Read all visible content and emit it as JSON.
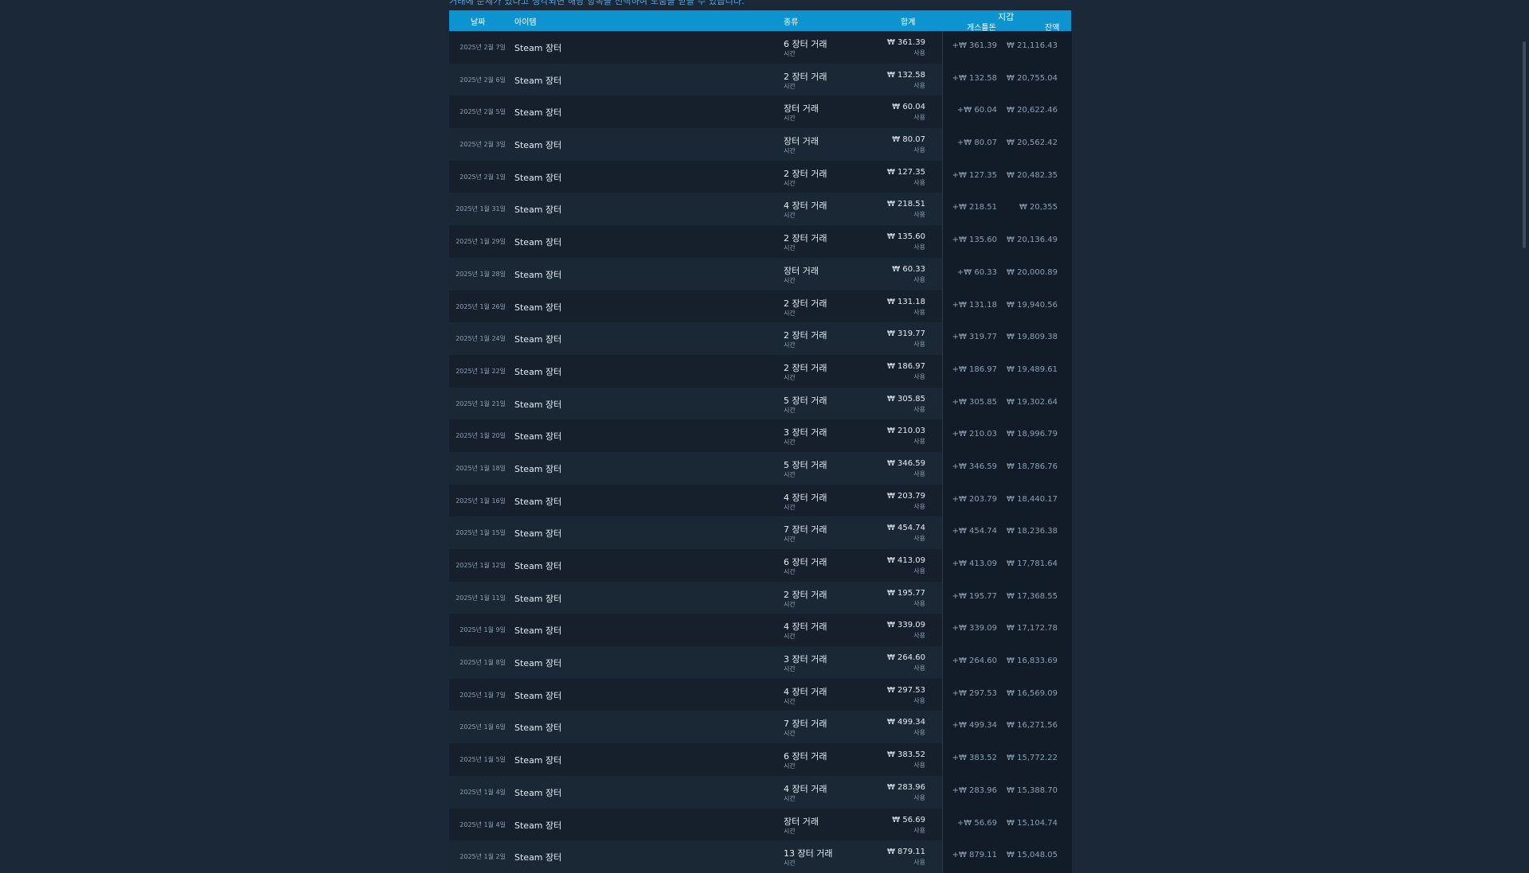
{
  "intro_text": "거래에 문제가 있다고 생각되면 해당 항목을 선택하여 도움을 받을 수 있습니다.",
  "headers": {
    "date": "날짜",
    "item": "아이템",
    "type": "종류",
    "total": "합계",
    "wallet": "지갑",
    "change": "게스틀돈",
    "balance": "잔액"
  },
  "rows": [
    {
      "date": "2025년 2월 7일",
      "item": "Steam 장터",
      "type": "6 장터 거래",
      "type_sub": "시간",
      "total": "₩ 361.39",
      "total_sub": "사용",
      "change": "+₩ 361.39",
      "balance": "₩ 21,116.43"
    },
    {
      "date": "2025년 2월 6일",
      "item": "Steam 장터",
      "type": "2 장터 거래",
      "type_sub": "시간",
      "total": "₩ 132.58",
      "total_sub": "사용",
      "change": "+₩ 132.58",
      "balance": "₩ 20,755.04"
    },
    {
      "date": "2025년 2월 5일",
      "item": "Steam 장터",
      "type": "장터 거래",
      "type_sub": "시간",
      "total": "₩ 60.04",
      "total_sub": "사용",
      "change": "+₩ 60.04",
      "balance": "₩ 20,622.46"
    },
    {
      "date": "2025년 2월 3일",
      "item": "Steam 장터",
      "type": "장터 거래",
      "type_sub": "시간",
      "total": "₩ 80.07",
      "total_sub": "사용",
      "change": "+₩ 80.07",
      "balance": "₩ 20,562.42"
    },
    {
      "date": "2025년 2월 1일",
      "item": "Steam 장터",
      "type": "2 장터 거래",
      "type_sub": "시간",
      "total": "₩ 127.35",
      "total_sub": "사용",
      "change": "+₩ 127.35",
      "balance": "₩ 20,482.35"
    },
    {
      "date": "2025년 1월 31일",
      "item": "Steam 장터",
      "type": "4 장터 거래",
      "type_sub": "시간",
      "total": "₩ 218.51",
      "total_sub": "사용",
      "change": "+₩ 218.51",
      "balance": "₩ 20,355"
    },
    {
      "date": "2025년 1월 29일",
      "item": "Steam 장터",
      "type": "2 장터 거래",
      "type_sub": "시간",
      "total": "₩ 135.60",
      "total_sub": "사용",
      "change": "+₩ 135.60",
      "balance": "₩ 20,136.49"
    },
    {
      "date": "2025년 1월 28일",
      "item": "Steam 장터",
      "type": "장터 거래",
      "type_sub": "시간",
      "total": "₩ 60.33",
      "total_sub": "사용",
      "change": "+₩ 60.33",
      "balance": "₩ 20,000.89"
    },
    {
      "date": "2025년 1월 26일",
      "item": "Steam 장터",
      "type": "2 장터 거래",
      "type_sub": "시간",
      "total": "₩ 131.18",
      "total_sub": "사용",
      "change": "+₩ 131.18",
      "balance": "₩ 19,940.56"
    },
    {
      "date": "2025년 1월 24일",
      "item": "Steam 장터",
      "type": "2 장터 거래",
      "type_sub": "시간",
      "total": "₩ 319.77",
      "total_sub": "사용",
      "change": "+₩ 319.77",
      "balance": "₩ 19,809.38"
    },
    {
      "date": "2025년 1월 22일",
      "item": "Steam 장터",
      "type": "2 장터 거래",
      "type_sub": "시간",
      "total": "₩ 186.97",
      "total_sub": "사용",
      "change": "+₩ 186.97",
      "balance": "₩ 19,489.61"
    },
    {
      "date": "2025년 1월 21일",
      "item": "Steam 장터",
      "type": "5 장터 거래",
      "type_sub": "시간",
      "total": "₩ 305.85",
      "total_sub": "사용",
      "change": "+₩ 305.85",
      "balance": "₩ 19,302.64"
    },
    {
      "date": "2025년 1월 20일",
      "item": "Steam 장터",
      "type": "3 장터 거래",
      "type_sub": "시간",
      "total": "₩ 210.03",
      "total_sub": "사용",
      "change": "+₩ 210.03",
      "balance": "₩ 18,996.79"
    },
    {
      "date": "2025년 1월 18일",
      "item": "Steam 장터",
      "type": "5 장터 거래",
      "type_sub": "시간",
      "total": "₩ 346.59",
      "total_sub": "사용",
      "change": "+₩ 346.59",
      "balance": "₩ 18,786.76"
    },
    {
      "date": "2025년 1월 16일",
      "item": "Steam 장터",
      "type": "4 장터 거래",
      "type_sub": "시간",
      "total": "₩ 203.79",
      "total_sub": "사용",
      "change": "+₩ 203.79",
      "balance": "₩ 18,440.17"
    },
    {
      "date": "2025년 1월 15일",
      "item": "Steam 장터",
      "type": "7 장터 거래",
      "type_sub": "시간",
      "total": "₩ 454.74",
      "total_sub": "사용",
      "change": "+₩ 454.74",
      "balance": "₩ 18,236.38"
    },
    {
      "date": "2025년 1월 12일",
      "item": "Steam 장터",
      "type": "6 장터 거래",
      "type_sub": "시간",
      "total": "₩ 413.09",
      "total_sub": "사용",
      "change": "+₩ 413.09",
      "balance": "₩ 17,781.64"
    },
    {
      "date": "2025년 1월 11일",
      "item": "Steam 장터",
      "type": "2 장터 거래",
      "type_sub": "시간",
      "total": "₩ 195.77",
      "total_sub": "사용",
      "change": "+₩ 195.77",
      "balance": "₩ 17,368.55"
    },
    {
      "date": "2025년 1월 9일",
      "item": "Steam 장터",
      "type": "4 장터 거래",
      "type_sub": "시간",
      "total": "₩ 339.09",
      "total_sub": "사용",
      "change": "+₩ 339.09",
      "balance": "₩ 17,172.78"
    },
    {
      "date": "2025년 1월 8일",
      "item": "Steam 장터",
      "type": "3 장터 거래",
      "type_sub": "시간",
      "total": "₩ 264.60",
      "total_sub": "사용",
      "change": "+₩ 264.60",
      "balance": "₩ 16,833.69"
    },
    {
      "date": "2025년 1월 7일",
      "item": "Steam 장터",
      "type": "4 장터 거래",
      "type_sub": "시간",
      "total": "₩ 297.53",
      "total_sub": "사용",
      "change": "+₩ 297.53",
      "balance": "₩ 16,569.09"
    },
    {
      "date": "2025년 1월 6일",
      "item": "Steam 장터",
      "type": "7 장터 거래",
      "type_sub": "시간",
      "total": "₩ 499.34",
      "total_sub": "사용",
      "change": "+₩ 499.34",
      "balance": "₩ 16,271.56"
    },
    {
      "date": "2025년 1월 5일",
      "item": "Steam 장터",
      "type": "6 장터 거래",
      "type_sub": "시간",
      "total": "₩ 383.52",
      "total_sub": "사용",
      "change": "+₩ 383.52",
      "balance": "₩ 15,772.22"
    },
    {
      "date": "2025년 1월 4일",
      "item": "Steam 장터",
      "type": "4 장터 거래",
      "type_sub": "시간",
      "total": "₩ 283.96",
      "total_sub": "사용",
      "change": "+₩ 283.96",
      "balance": "₩ 15,388.70"
    },
    {
      "date": "2025년 1월 4일",
      "item": "Steam 장터",
      "type": "장터 거래",
      "type_sub": "시간",
      "total": "₩ 56.69",
      "total_sub": "사용",
      "change": "+₩ 56.69",
      "balance": "₩ 15,104.74"
    },
    {
      "date": "2025년 1월 2일",
      "item": "Steam 장터",
      "type": "13 장터 거래",
      "type_sub": "시간",
      "total": "₩ 879.11",
      "total_sub": "사용",
      "change": "+₩ 879.11",
      "balance": "₩ 15,048.05"
    }
  ],
  "colors": {
    "background": "#1b2838",
    "header": "#0d93d0",
    "row_dark": "#16202d",
    "row_light": "#1a2735"
  }
}
